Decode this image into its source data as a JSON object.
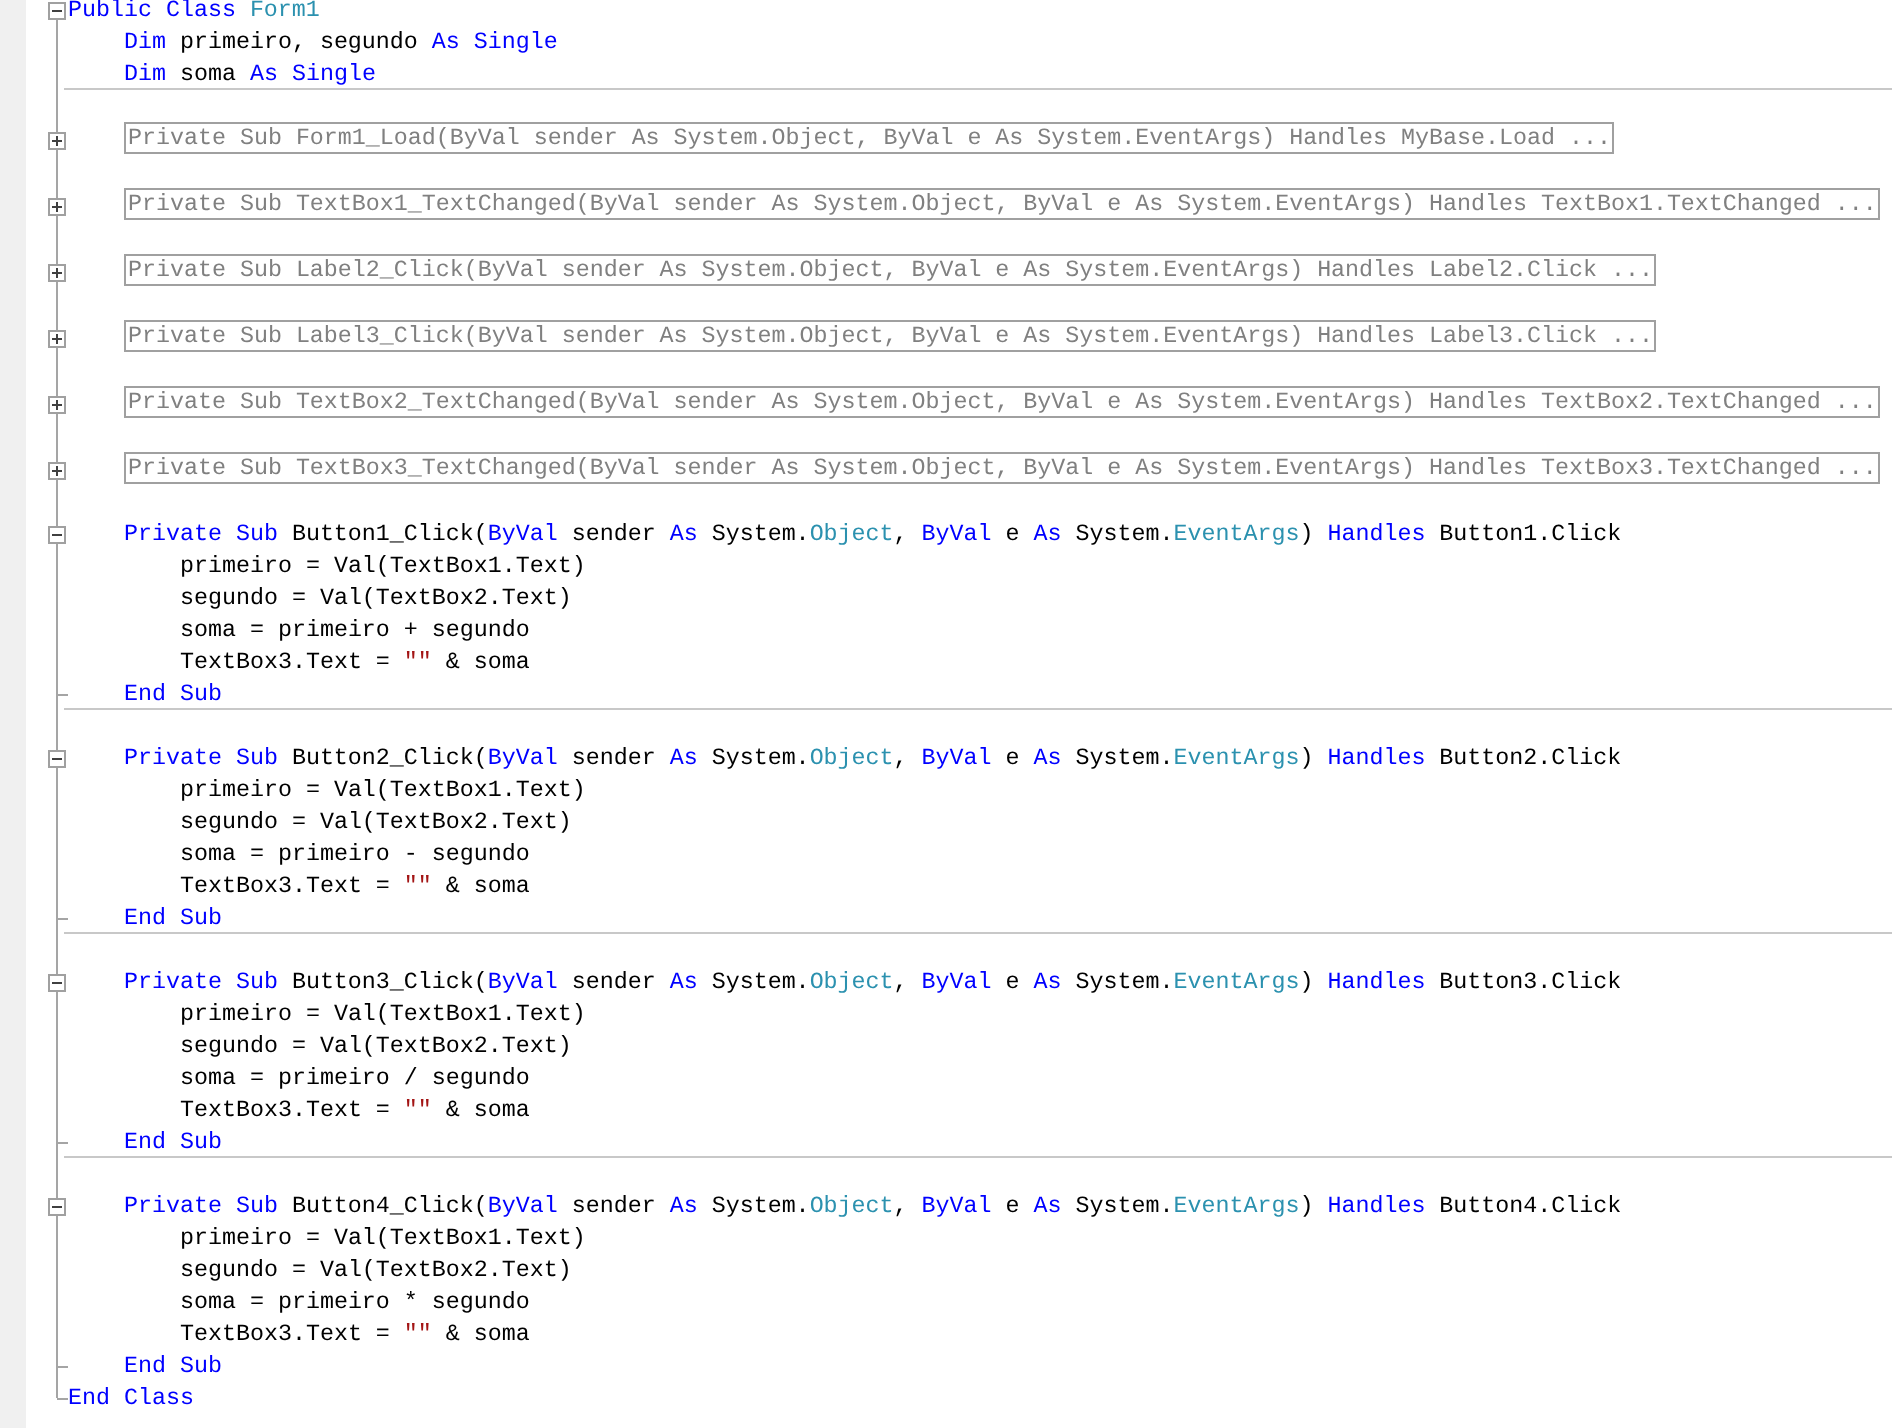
{
  "lines": [
    {
      "kind": "block",
      "expanded": true,
      "tokens": [
        {
          "kind": "kw",
          "text": "Public Class "
        },
        {
          "kind": "type",
          "text": "Form1"
        }
      ],
      "end": [
        {
          "kind": "kw",
          "text": "End Class"
        }
      ],
      "children": [
        {
          "kind": "code",
          "tokens": [
            {
              "kind": "kw",
              "text": "Dim"
            },
            {
              "kind": "text",
              "text": " primeiro, segundo "
            },
            {
              "kind": "kw",
              "text": "As Single"
            }
          ]
        },
        {
          "kind": "code",
          "separator": true,
          "tokens": [
            {
              "kind": "kw",
              "text": "Dim"
            },
            {
              "kind": "text",
              "text": " soma "
            },
            {
              "kind": "kw",
              "text": "As Single"
            }
          ]
        },
        {
          "kind": "blank"
        },
        {
          "kind": "collapsed",
          "expanded": false,
          "text": "Private Sub Form1_Load(ByVal sender As System.Object, ByVal e As System.EventArgs) Handles MyBase.Load ..."
        },
        {
          "kind": "blank"
        },
        {
          "kind": "collapsed",
          "expanded": false,
          "text": "Private Sub TextBox1_TextChanged(ByVal sender As System.Object, ByVal e As System.EventArgs) Handles TextBox1.TextChanged ..."
        },
        {
          "kind": "blank"
        },
        {
          "kind": "collapsed",
          "expanded": false,
          "text": "Private Sub Label2_Click(ByVal sender As System.Object, ByVal e As System.EventArgs) Handles Label2.Click ..."
        },
        {
          "kind": "blank"
        },
        {
          "kind": "collapsed",
          "expanded": false,
          "text": "Private Sub Label3_Click(ByVal sender As System.Object, ByVal e As System.EventArgs) Handles Label3.Click ..."
        },
        {
          "kind": "blank"
        },
        {
          "kind": "collapsed",
          "expanded": false,
          "text": "Private Sub TextBox2_TextChanged(ByVal sender As System.Object, ByVal e As System.EventArgs) Handles TextBox2.TextChanged ..."
        },
        {
          "kind": "blank"
        },
        {
          "kind": "collapsed",
          "expanded": false,
          "text": "Private Sub TextBox3_TextChanged(ByVal sender As System.Object, ByVal e As System.EventArgs) Handles TextBox3.TextChanged ..."
        },
        {
          "kind": "blank"
        },
        {
          "kind": "block",
          "expanded": true,
          "separator": true,
          "tokens": [
            {
              "kind": "kw",
              "text": "Private Sub"
            },
            {
              "kind": "text",
              "text": " Button1_Click("
            },
            {
              "kind": "kw",
              "text": "ByVal"
            },
            {
              "kind": "text",
              "text": " sender "
            },
            {
              "kind": "kw",
              "text": "As"
            },
            {
              "kind": "text",
              "text": " System."
            },
            {
              "kind": "type",
              "text": "Object"
            },
            {
              "kind": "text",
              "text": ", "
            },
            {
              "kind": "kw",
              "text": "ByVal"
            },
            {
              "kind": "text",
              "text": " e "
            },
            {
              "kind": "kw",
              "text": "As"
            },
            {
              "kind": "text",
              "text": " System."
            },
            {
              "kind": "type",
              "text": "EventArgs"
            },
            {
              "kind": "text",
              "text": ") "
            },
            {
              "kind": "kw",
              "text": "Handles"
            },
            {
              "kind": "text",
              "text": " Button1.Click"
            }
          ],
          "end": [
            {
              "kind": "kw",
              "text": "End Sub"
            }
          ],
          "children": [
            {
              "kind": "code",
              "tokens": [
                {
                  "kind": "text",
                  "text": "primeiro = Val(TextBox1.Text)"
                }
              ]
            },
            {
              "kind": "code",
              "tokens": [
                {
                  "kind": "text",
                  "text": "segundo = Val(TextBox2.Text)"
                }
              ]
            },
            {
              "kind": "code",
              "tokens": [
                {
                  "kind": "text",
                  "text": "soma = primeiro + segundo"
                }
              ]
            },
            {
              "kind": "code",
              "tokens": [
                {
                  "kind": "text",
                  "text": "TextBox3.Text = "
                },
                {
                  "kind": "str",
                  "text": "\"\""
                },
                {
                  "kind": "text",
                  "text": " & soma"
                }
              ]
            }
          ]
        },
        {
          "kind": "blank"
        },
        {
          "kind": "block",
          "expanded": true,
          "separator": true,
          "tokens": [
            {
              "kind": "kw",
              "text": "Private Sub"
            },
            {
              "kind": "text",
              "text": " Button2_Click("
            },
            {
              "kind": "kw",
              "text": "ByVal"
            },
            {
              "kind": "text",
              "text": " sender "
            },
            {
              "kind": "kw",
              "text": "As"
            },
            {
              "kind": "text",
              "text": " System."
            },
            {
              "kind": "type",
              "text": "Object"
            },
            {
              "kind": "text",
              "text": ", "
            },
            {
              "kind": "kw",
              "text": "ByVal"
            },
            {
              "kind": "text",
              "text": " e "
            },
            {
              "kind": "kw",
              "text": "As"
            },
            {
              "kind": "text",
              "text": " System."
            },
            {
              "kind": "type",
              "text": "EventArgs"
            },
            {
              "kind": "text",
              "text": ") "
            },
            {
              "kind": "kw",
              "text": "Handles"
            },
            {
              "kind": "text",
              "text": " Button2.Click"
            }
          ],
          "end": [
            {
              "kind": "kw",
              "text": "End Sub"
            }
          ],
          "children": [
            {
              "kind": "code",
              "tokens": [
                {
                  "kind": "text",
                  "text": "primeiro = Val(TextBox1.Text)"
                }
              ]
            },
            {
              "kind": "code",
              "tokens": [
                {
                  "kind": "text",
                  "text": "segundo = Val(TextBox2.Text)"
                }
              ]
            },
            {
              "kind": "code",
              "tokens": [
                {
                  "kind": "text",
                  "text": "soma = primeiro - segundo"
                }
              ]
            },
            {
              "kind": "code",
              "tokens": [
                {
                  "kind": "text",
                  "text": "TextBox3.Text = "
                },
                {
                  "kind": "str",
                  "text": "\"\""
                },
                {
                  "kind": "text",
                  "text": " & soma"
                }
              ]
            }
          ]
        },
        {
          "kind": "blank"
        },
        {
          "kind": "block",
          "expanded": true,
          "separator": true,
          "tokens": [
            {
              "kind": "kw",
              "text": "Private Sub"
            },
            {
              "kind": "text",
              "text": " Button3_Click("
            },
            {
              "kind": "kw",
              "text": "ByVal"
            },
            {
              "kind": "text",
              "text": " sender "
            },
            {
              "kind": "kw",
              "text": "As"
            },
            {
              "kind": "text",
              "text": " System."
            },
            {
              "kind": "type",
              "text": "Object"
            },
            {
              "kind": "text",
              "text": ", "
            },
            {
              "kind": "kw",
              "text": "ByVal"
            },
            {
              "kind": "text",
              "text": " e "
            },
            {
              "kind": "kw",
              "text": "As"
            },
            {
              "kind": "text",
              "text": " System."
            },
            {
              "kind": "type",
              "text": "EventArgs"
            },
            {
              "kind": "text",
              "text": ") "
            },
            {
              "kind": "kw",
              "text": "Handles"
            },
            {
              "kind": "text",
              "text": " Button3.Click"
            }
          ],
          "end": [
            {
              "kind": "kw",
              "text": "End Sub"
            }
          ],
          "children": [
            {
              "kind": "code",
              "tokens": [
                {
                  "kind": "text",
                  "text": "primeiro = Val(TextBox1.Text)"
                }
              ]
            },
            {
              "kind": "code",
              "tokens": [
                {
                  "kind": "text",
                  "text": "segundo = Val(TextBox2.Text)"
                }
              ]
            },
            {
              "kind": "code",
              "tokens": [
                {
                  "kind": "text",
                  "text": "soma = primeiro / segundo"
                }
              ]
            },
            {
              "kind": "code",
              "tokens": [
                {
                  "kind": "text",
                  "text": "TextBox3.Text = "
                },
                {
                  "kind": "str",
                  "text": "\"\""
                },
                {
                  "kind": "text",
                  "text": " & soma"
                }
              ]
            }
          ]
        },
        {
          "kind": "blank"
        },
        {
          "kind": "block",
          "expanded": true,
          "tokens": [
            {
              "kind": "kw",
              "text": "Private Sub"
            },
            {
              "kind": "text",
              "text": " Button4_Click("
            },
            {
              "kind": "kw",
              "text": "ByVal"
            },
            {
              "kind": "text",
              "text": " sender "
            },
            {
              "kind": "kw",
              "text": "As"
            },
            {
              "kind": "text",
              "text": " System."
            },
            {
              "kind": "type",
              "text": "Object"
            },
            {
              "kind": "text",
              "text": ", "
            },
            {
              "kind": "kw",
              "text": "ByVal"
            },
            {
              "kind": "text",
              "text": " e "
            },
            {
              "kind": "kw",
              "text": "As"
            },
            {
              "kind": "text",
              "text": " System."
            },
            {
              "kind": "type",
              "text": "EventArgs"
            },
            {
              "kind": "text",
              "text": ") "
            },
            {
              "kind": "kw",
              "text": "Handles"
            },
            {
              "kind": "text",
              "text": " Button4.Click"
            }
          ],
          "end": [
            {
              "kind": "kw",
              "text": "End Sub"
            }
          ],
          "children": [
            {
              "kind": "code",
              "tokens": [
                {
                  "kind": "text",
                  "text": "primeiro = Val(TextBox1.Text)"
                }
              ]
            },
            {
              "kind": "code",
              "tokens": [
                {
                  "kind": "text",
                  "text": "segundo = Val(TextBox2.Text)"
                }
              ]
            },
            {
              "kind": "code",
              "tokens": [
                {
                  "kind": "text",
                  "text": "soma = primeiro * segundo"
                }
              ]
            },
            {
              "kind": "code",
              "tokens": [
                {
                  "kind": "text",
                  "text": "TextBox3.Text = "
                },
                {
                  "kind": "str",
                  "text": "\"\""
                },
                {
                  "kind": "text",
                  "text": " & soma"
                }
              ]
            }
          ]
        }
      ]
    }
  ]
}
